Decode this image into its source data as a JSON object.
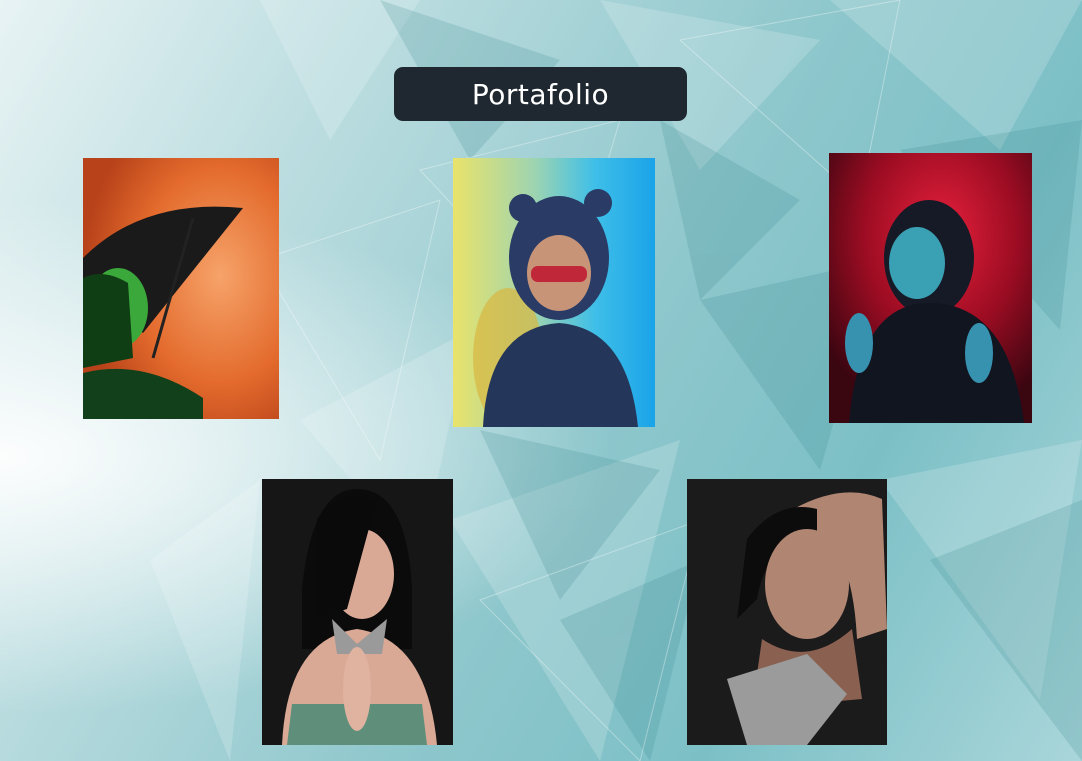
{
  "title": "Portafolio",
  "photos": [
    {
      "name": "photo-umbrella-woman",
      "icon": "photo-thumbnail"
    },
    {
      "name": "photo-child-bear-hood",
      "icon": "photo-thumbnail"
    },
    {
      "name": "photo-woman-red-light",
      "icon": "photo-thumbnail"
    },
    {
      "name": "photo-woman-praying",
      "icon": "photo-thumbnail"
    },
    {
      "name": "photo-woman-arm-raised",
      "icon": "photo-thumbnail"
    }
  ],
  "colors": {
    "title_bg": "#1f2830",
    "title_text": "#ffffff",
    "background_teal": "#7cc0c6"
  }
}
